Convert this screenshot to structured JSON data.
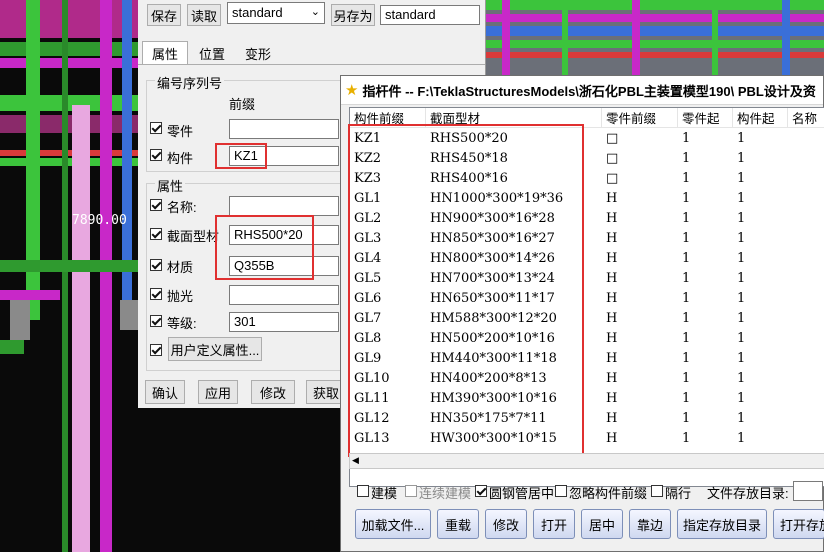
{
  "viewport": {
    "dimension_text": "7890.00"
  },
  "panel": {
    "toolbar": {
      "save": "保存",
      "load": "读取",
      "preset": "standard",
      "save_as": "另存为",
      "save_as_name": "standard"
    },
    "tabs": [
      "属性",
      "位置",
      "变形"
    ],
    "numbering": {
      "group_title": "编号序列号",
      "prefix_header": "前缀",
      "part_label": "零件",
      "part_value": "",
      "assembly_label": "构件",
      "assembly_value": "KZ1"
    },
    "attributes": {
      "group_title": "属性",
      "name_label": "名称:",
      "name_value": "",
      "profile_label": "截面型材",
      "profile_value": "RHS500*20",
      "material_label": "材质",
      "material_value": "Q355B",
      "finish_label": "抛光",
      "finish_value": "",
      "class_label": "等级:",
      "class_value": "301",
      "udf_button": "用户定义属性..."
    },
    "bottom_buttons": [
      "确认",
      "应用",
      "修改",
      "获取"
    ]
  },
  "dialog": {
    "title": "指杆件  -- F:\\TeklaStructuresModels\\浙石化PBL主装置模型190\\ PBL设计及资",
    "columns": [
      "构件前缀",
      "截面型材",
      "零件前缀",
      "零件起",
      "构件起",
      "名称"
    ],
    "rows": [
      {
        "prefix": "KZ1",
        "profile": "RHS500*20",
        "part_prefix": "□",
        "part_start": "1",
        "asm_start": "1"
      },
      {
        "prefix": "KZ2",
        "profile": "RHS450*18",
        "part_prefix": "□",
        "part_start": "1",
        "asm_start": "1"
      },
      {
        "prefix": "KZ3",
        "profile": "RHS400*16",
        "part_prefix": "□",
        "part_start": "1",
        "asm_start": "1"
      },
      {
        "prefix": "GL1",
        "profile": "HN1000*300*19*36",
        "part_prefix": "H",
        "part_start": "1",
        "asm_start": "1"
      },
      {
        "prefix": "GL2",
        "profile": "HN900*300*16*28",
        "part_prefix": "H",
        "part_start": "1",
        "asm_start": "1"
      },
      {
        "prefix": "GL3",
        "profile": "HN850*300*16*27",
        "part_prefix": "H",
        "part_start": "1",
        "asm_start": "1"
      },
      {
        "prefix": "GL4",
        "profile": "HN800*300*14*26",
        "part_prefix": "H",
        "part_start": "1",
        "asm_start": "1"
      },
      {
        "prefix": "GL5",
        "profile": "HN700*300*13*24",
        "part_prefix": "H",
        "part_start": "1",
        "asm_start": "1"
      },
      {
        "prefix": "GL6",
        "profile": "HN650*300*11*17",
        "part_prefix": "H",
        "part_start": "1",
        "asm_start": "1"
      },
      {
        "prefix": "GL7",
        "profile": "HM588*300*12*20",
        "part_prefix": "H",
        "part_start": "1",
        "asm_start": "1"
      },
      {
        "prefix": "GL8",
        "profile": "HN500*200*10*16",
        "part_prefix": "H",
        "part_start": "1",
        "asm_start": "1"
      },
      {
        "prefix": "GL9",
        "profile": "HM440*300*11*18",
        "part_prefix": "H",
        "part_start": "1",
        "asm_start": "1"
      },
      {
        "prefix": "GL10",
        "profile": "HN400*200*8*13",
        "part_prefix": "H",
        "part_start": "1",
        "asm_start": "1"
      },
      {
        "prefix": "GL11",
        "profile": "HM390*300*10*16",
        "part_prefix": "H",
        "part_start": "1",
        "asm_start": "1"
      },
      {
        "prefix": "GL12",
        "profile": "HN350*175*7*11",
        "part_prefix": "H",
        "part_start": "1",
        "asm_start": "1"
      },
      {
        "prefix": "GL13",
        "profile": "HW300*300*10*15",
        "part_prefix": "H",
        "part_start": "1",
        "asm_start": "1"
      }
    ],
    "options": {
      "model": {
        "label": "建模",
        "checked": false
      },
      "continuous": {
        "label": "连续建模",
        "checked": false
      },
      "pipe_center": {
        "label": "圆钢管居中",
        "checked": true
      },
      "ignore_prefix": {
        "label": "忽略构件前缀",
        "checked": false
      },
      "alt_rows": {
        "label": "隔行",
        "checked": false
      },
      "save_dir_label": "文件存放目录:"
    },
    "buttons": [
      "加载文件...",
      "重载",
      "修改",
      "打开",
      "居中",
      "靠边",
      "指定存放目录",
      "打开存放"
    ]
  },
  "colors": {
    "highlight_box": "#e03030",
    "steel_green": "#3cc43c",
    "steel_magenta": "#c828c8",
    "steel_blue": "#3a6fd8"
  }
}
